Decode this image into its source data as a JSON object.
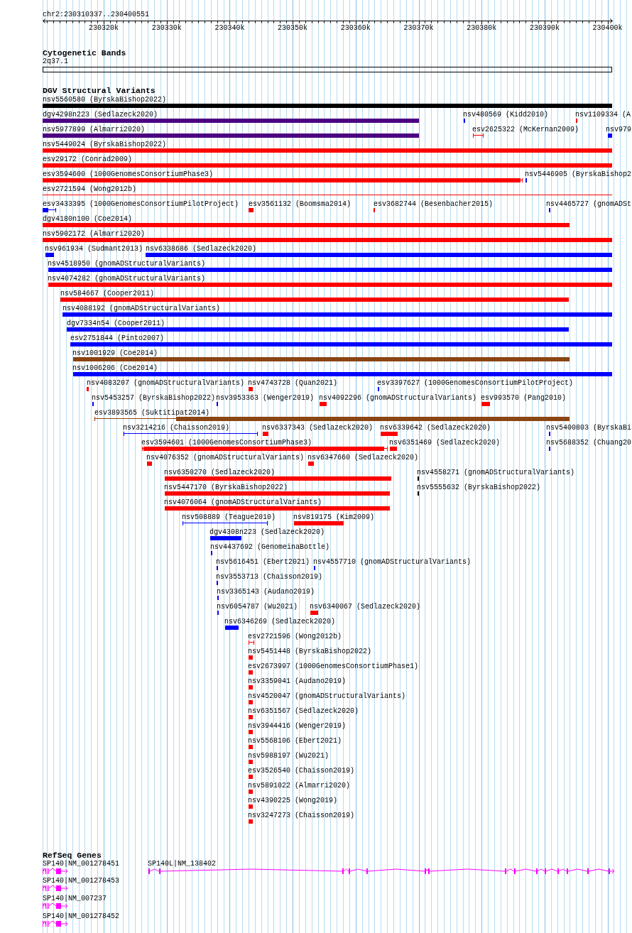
{
  "ruler": {
    "location": "chr2:230310337..230400551",
    "tick_labels": [
      "230320k",
      "230330k",
      "230340k",
      "230350k",
      "230360k",
      "230370k",
      "230380k",
      "230390k",
      "230400k"
    ]
  },
  "tracks": [
    {
      "kind": "bands",
      "title": "Cytogenetic Bands",
      "features": [
        {
          "label": "2q37.1"
        }
      ]
    },
    {
      "kind": "variants",
      "title": "DGV Structural Variants",
      "features": [
        {
          "label": "nsv5560580 (ByrskaBishop2022)",
          "color": "#000000",
          "kind": "bar"
        },
        {
          "label": "dgv4298n223 (Sedlazeck2020)",
          "color": "#4b0082",
          "kind": "bar"
        },
        {
          "label": "nsv480569 (Kidd2010)",
          "color": "#0000ff",
          "kind": "bar"
        },
        {
          "label": "nsv1109334 (A",
          "color": "#ff0000",
          "kind": "bar"
        },
        {
          "label": "nsv5977899 (Almarri2020)",
          "color": "#4b0082",
          "kind": "bar"
        },
        {
          "label": "esv2625322 (McKernan2009)",
          "color": "#ff0000",
          "kind": "interval"
        },
        {
          "label": "nsv979",
          "color": "#0000ff",
          "kind": "bar"
        },
        {
          "label": "nsv5449024 (ByrskaBishop2022)",
          "color": "#ff0000",
          "kind": "bar"
        },
        {
          "label": "esv29172 (Conrad2009)",
          "color": "#ff0000",
          "kind": "bar"
        },
        {
          "label": "esv3594600 (1000GenomesConsortiumPhase3)",
          "color": "#ff0000",
          "kind": "mixed"
        },
        {
          "label": "nsv5446905 (ByrskaBishop2",
          "color": "#0000ff",
          "kind": "bar"
        },
        {
          "label": "esv2721594 (Wong2012b)",
          "color": "#ff0000",
          "kind": "interval"
        },
        {
          "label": "esv3433395 (1000GenomesConsortiumPilotProject)",
          "color": "#0000ff",
          "kind": "mixed"
        },
        {
          "label": "esv3561132 (Boomsma2014)",
          "color": "#ff0000",
          "kind": "bar"
        },
        {
          "label": "esv3682744 (Besenbacher2015)",
          "color": "#ff0000",
          "kind": "bar"
        },
        {
          "label": "nsv4465727 (gnomADSt",
          "color": "#0000ff",
          "kind": "bar"
        },
        {
          "label": "dgv4180n100 (Coe2014)",
          "color": "#ff0000",
          "kind": "bar"
        },
        {
          "label": "nsv5902172 (Almarri2020)",
          "color": "#ff0000",
          "kind": "bar"
        },
        {
          "label": "nsv961934 (Sudmant2013)",
          "color": "#0000ff",
          "kind": "bar"
        },
        {
          "label": "nsv6338686 (Sedlazeck2020)",
          "color": "#0000ff",
          "kind": "bar"
        },
        {
          "label": "nsv4518950 (gnomADStructuralVariants)",
          "color": "#0000ff",
          "kind": "bar"
        },
        {
          "label": "nsv4074282 (gnomADStructuralVariants)",
          "color": "#ff0000",
          "kind": "bar"
        },
        {
          "label": "nsv584667 (Cooper2011)",
          "color": "#ff0000",
          "kind": "bar"
        },
        {
          "label": "nsv4088192 (gnomADStructuralVariants)",
          "color": "#0000ff",
          "kind": "bar"
        },
        {
          "label": "dgv7334n54 (Cooper2011)",
          "color": "#0000ff",
          "kind": "bar"
        },
        {
          "label": "esv2751844 (Pinto2007)",
          "color": "#0000ff",
          "kind": "bar"
        },
        {
          "label": "nsv1001929 (Coe2014)",
          "color": "#8b4513",
          "kind": "bar"
        },
        {
          "label": "nsv1006206 (Coe2014)",
          "color": "#0000ff",
          "kind": "bar"
        },
        {
          "label": "nsv4083207 (gnomADStructuralVariants)",
          "color": "#ff0000",
          "kind": "bar"
        },
        {
          "label": "nsv4743728 (Quan2021)",
          "color": "#ff0000",
          "kind": "bar"
        },
        {
          "label": "esv3397627 (1000GenomesConsortiumPilotProject)",
          "color": "#0000ff",
          "kind": "bar"
        },
        {
          "label": "nsv5453257 (ByrskaBishop2022)",
          "color": "#0000ff",
          "kind": "bar"
        },
        {
          "label": "nsv3953363 (Wenger2019)",
          "color": "#0000ff",
          "kind": "bar"
        },
        {
          "label": "nsv4092296 (gnomADStructuralVariants)",
          "color": "#ff0000",
          "kind": "bar"
        },
        {
          "label": "esv993570 (Pang2010)",
          "color": "#ff0000",
          "kind": "bar"
        },
        {
          "label": "esv3893565 (Suktitipat2014)",
          "color": "#8b4513",
          "kind": "mixed"
        },
        {
          "label": "nsv3214216 (Chaisson2019)",
          "color": "#0000ff",
          "kind": "interval"
        },
        {
          "label": "nsv6337343 (Sedlazeck2020)",
          "color": "#ff0000",
          "kind": "bar"
        },
        {
          "label": "nsv6339642 (Sedlazeck2020)",
          "color": "#ff0000",
          "kind": "bar"
        },
        {
          "label": "nsv5400803 (ByrskaBi",
          "color": "#0000ff",
          "kind": "bar"
        },
        {
          "label": "esv3594601 (1000GenomesConsortiumPhase3)",
          "color": "#ff0000",
          "kind": "mixed"
        },
        {
          "label": "nsv6351469 (Sedlazeck2020)",
          "color": "#ff0000",
          "kind": "bar"
        },
        {
          "label": "nsv5688352 (Chuang20",
          "color": "#0000ff",
          "kind": "bar"
        },
        {
          "label": "nsv4076352 (gnomADStructuralVariants)",
          "color": "#ff0000",
          "kind": "bar"
        },
        {
          "label": "nsv6347660 (Sedlazeck2020)",
          "color": "#ff0000",
          "kind": "bar"
        },
        {
          "label": "nsv6350270 (Sedlazeck2020)",
          "color": "#ff0000",
          "kind": "bar"
        },
        {
          "label": "nsv4558271 (gnomADStructuralVariants)",
          "color": "#000000",
          "kind": "bar"
        },
        {
          "label": "nsv5447170 (ByrskaBishop2022)",
          "color": "#ff0000",
          "kind": "bar"
        },
        {
          "label": "nsv5555632 (ByrskaBishop2022)",
          "color": "#000000",
          "kind": "bar"
        },
        {
          "label": "nsv4076064 (gnomADStructuralVariants)",
          "color": "#ff0000",
          "kind": "bar"
        },
        {
          "label": "nsv508889 (Teague2010)",
          "color": "#0000ff",
          "kind": "interval"
        },
        {
          "label": "nsv819175 (Kim2009)",
          "color": "#ff0000",
          "kind": "bar"
        },
        {
          "label": "dgv4308n223 (Sedlazeck2020)",
          "color": "#0000ff",
          "kind": "bar"
        },
        {
          "label": "nsv4437692 (GenomeinaBottle)",
          "color": "#0000ff",
          "kind": "bar"
        },
        {
          "label": "nsv5616451 (Ebert2021)",
          "color": "#0000ff",
          "kind": "bar"
        },
        {
          "label": "nsv4557710 (gnomADStructuralVariants)",
          "color": "#0000ff",
          "kind": "bar"
        },
        {
          "label": "nsv3553713 (Chaisson2019)",
          "color": "#0000ff",
          "kind": "bar"
        },
        {
          "label": "nsv3365143 (Audano2019)",
          "color": "#0000ff",
          "kind": "bar"
        },
        {
          "label": "nsv6054787 (Wu2021)",
          "color": "#0000ff",
          "kind": "bar"
        },
        {
          "label": "nsv6340067 (Sedlazeck2020)",
          "color": "#ff0000",
          "kind": "bar"
        },
        {
          "label": "nsv6346269 (Sedlazeck2020)",
          "color": "#0000ff",
          "kind": "bar"
        },
        {
          "label": "esv2721596 (Wong2012b)",
          "color": "#ff0000",
          "kind": "interval"
        },
        {
          "label": "nsv5451448 (ByrskaBishop2022)",
          "color": "#ff0000",
          "kind": "bar"
        },
        {
          "label": "esv2673997 (1000GenomesConsortiumPhase1)",
          "color": "#ff0000",
          "kind": "bar"
        },
        {
          "label": "nsv3359041 (Audano2019)",
          "color": "#ff0000",
          "kind": "bar"
        },
        {
          "label": "nsv4520047 (gnomADStructuralVariants)",
          "color": "#ff0000",
          "kind": "bar"
        },
        {
          "label": "nsv6351567 (Sedlazeck2020)",
          "color": "#ff0000",
          "kind": "bar"
        },
        {
          "label": "nsv3944416 (Wenger2019)",
          "color": "#ff0000",
          "kind": "bar"
        },
        {
          "label": "nsv5568106 (Ebert2021)",
          "color": "#ff0000",
          "kind": "bar"
        },
        {
          "label": "nsv5988197 (Wu2021)",
          "color": "#ff0000",
          "kind": "bar"
        },
        {
          "label": "esv3526540 (Chaisson2019)",
          "color": "#ff0000",
          "kind": "bar"
        },
        {
          "label": "nsv5891022 (Almarri2020)",
          "color": "#ff0000",
          "kind": "bar"
        },
        {
          "label": "nsv4390225 (Wong2019)",
          "color": "#ff0000",
          "kind": "bar"
        },
        {
          "label": "nsv3247273 (Chaisson2019)",
          "color": "#ff0000",
          "kind": "bar"
        }
      ]
    },
    {
      "kind": "genes",
      "title": "RefSeq Genes",
      "features": [
        {
          "label": "SP140|NM_001278451"
        },
        {
          "label": "SP140L|NM_138402"
        },
        {
          "label": "SP140|NM_001278453"
        },
        {
          "label": "SP140|NM_007237"
        },
        {
          "label": "SP140|NM_001278452"
        }
      ]
    }
  ]
}
